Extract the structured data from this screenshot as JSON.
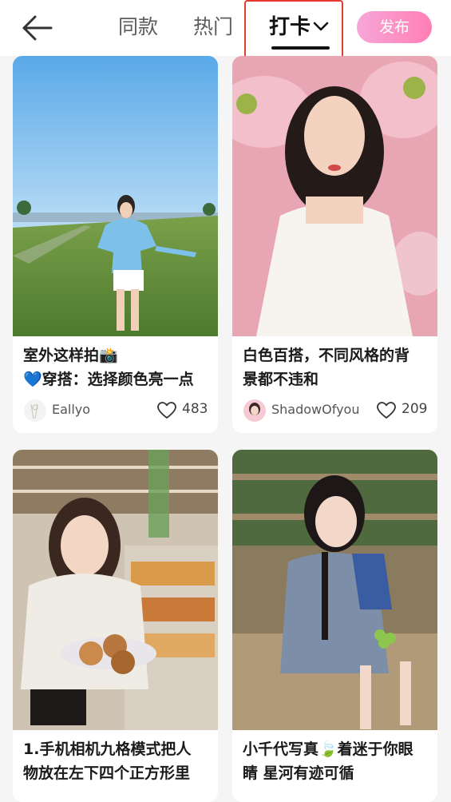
{
  "nav": {
    "back_icon": "back-arrow-icon",
    "tabs": [
      {
        "label": "同款"
      },
      {
        "label": "热门"
      },
      {
        "label": "打卡",
        "active": true
      }
    ],
    "publish_label": "发布",
    "accent_color": "#ff7fb5"
  },
  "feed": [
    {
      "title_line1": "室外这样拍📸",
      "title_line2": "💙穿搭：选择颜色亮一点",
      "author": "Eallyo",
      "likes": "483"
    },
    {
      "title_line1": "白色百搭，不同风格的背",
      "title_line2": "景都不违和",
      "author": "ShadowOfyou",
      "likes": "209"
    },
    {
      "title_line1": "1.手机相机九格模式把人",
      "title_line2": "物放在左下四个正方形里",
      "author": "",
      "likes": ""
    },
    {
      "title_line1": "小千代写真🍃着迷于你眼",
      "title_line2": "睛 星河有迹可循",
      "author": "",
      "likes": ""
    }
  ]
}
